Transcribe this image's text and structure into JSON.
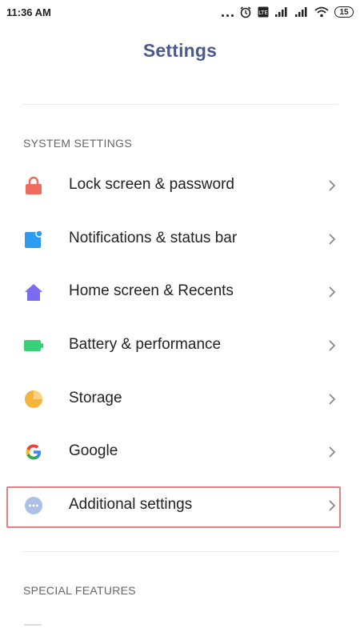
{
  "status_bar": {
    "time": "11:36 AM",
    "battery_level": "15",
    "icons": [
      "more-dots-icon",
      "alarm-icon",
      "volte-icon",
      "signal-icon",
      "signal-icon",
      "wifi-icon",
      "battery-icon"
    ]
  },
  "header": {
    "title": "Settings"
  },
  "sections": [
    {
      "title": "SYSTEM SETTINGS",
      "items": [
        {
          "label": "Lock screen & password",
          "icon": "lock-icon",
          "color": "#ef6b5f"
        },
        {
          "label": "Notifications & status bar",
          "icon": "notification-icon",
          "color": "#2b9cf0"
        },
        {
          "label": "Home screen & Recents",
          "icon": "home-icon",
          "color": "#7a6cf0"
        },
        {
          "label": "Battery & performance",
          "icon": "battery-icon",
          "color": "#3ad07a"
        },
        {
          "label": "Storage",
          "icon": "storage-pie-icon",
          "color": "#f5b53c"
        },
        {
          "label": "Google",
          "icon": "google-icon",
          "color": "#4285f4"
        },
        {
          "label": "Additional settings",
          "icon": "more-icon",
          "color": "#aebfe6",
          "highlighted": true
        }
      ]
    },
    {
      "title": "SPECIAL FEATURES",
      "items": []
    }
  ]
}
